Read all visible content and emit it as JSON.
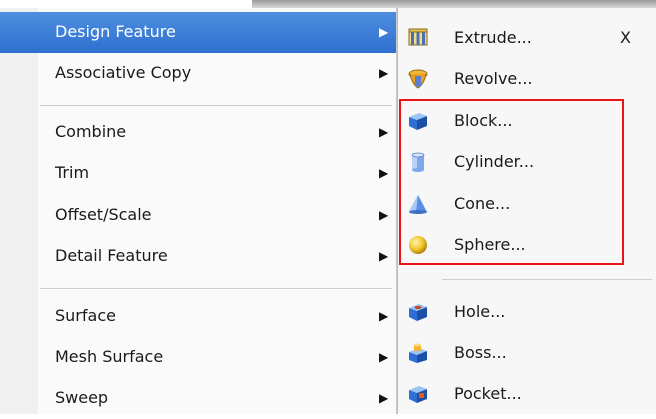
{
  "main_menu": {
    "items": [
      {
        "label": "Design Feature",
        "active": true
      },
      {
        "label": "Associative Copy"
      },
      {
        "label": "Combine"
      },
      {
        "label": "Trim"
      },
      {
        "label": "Offset/Scale"
      },
      {
        "label": "Detail Feature"
      },
      {
        "label": "Surface"
      },
      {
        "label": "Mesh Surface"
      },
      {
        "label": "Sweep"
      }
    ],
    "arrow": "▶"
  },
  "submenu": {
    "items": [
      {
        "label": "Extrude...",
        "accelerator": "X",
        "icon": "extrude-icon"
      },
      {
        "label": "Revolve...",
        "icon": "revolve-icon"
      },
      {
        "label": "Block...",
        "icon": "block-icon"
      },
      {
        "label": "Cylinder...",
        "icon": "cylinder-icon"
      },
      {
        "label": "Cone...",
        "icon": "cone-icon"
      },
      {
        "label": "Sphere...",
        "icon": "sphere-icon"
      },
      {
        "label": "Hole...",
        "icon": "hole-icon"
      },
      {
        "label": "Boss...",
        "icon": "boss-icon"
      },
      {
        "label": "Pocket...",
        "icon": "pocket-icon"
      }
    ]
  },
  "colors": {
    "active_highlight": "#3a7bd9",
    "annotation_box": "#e8141b"
  }
}
